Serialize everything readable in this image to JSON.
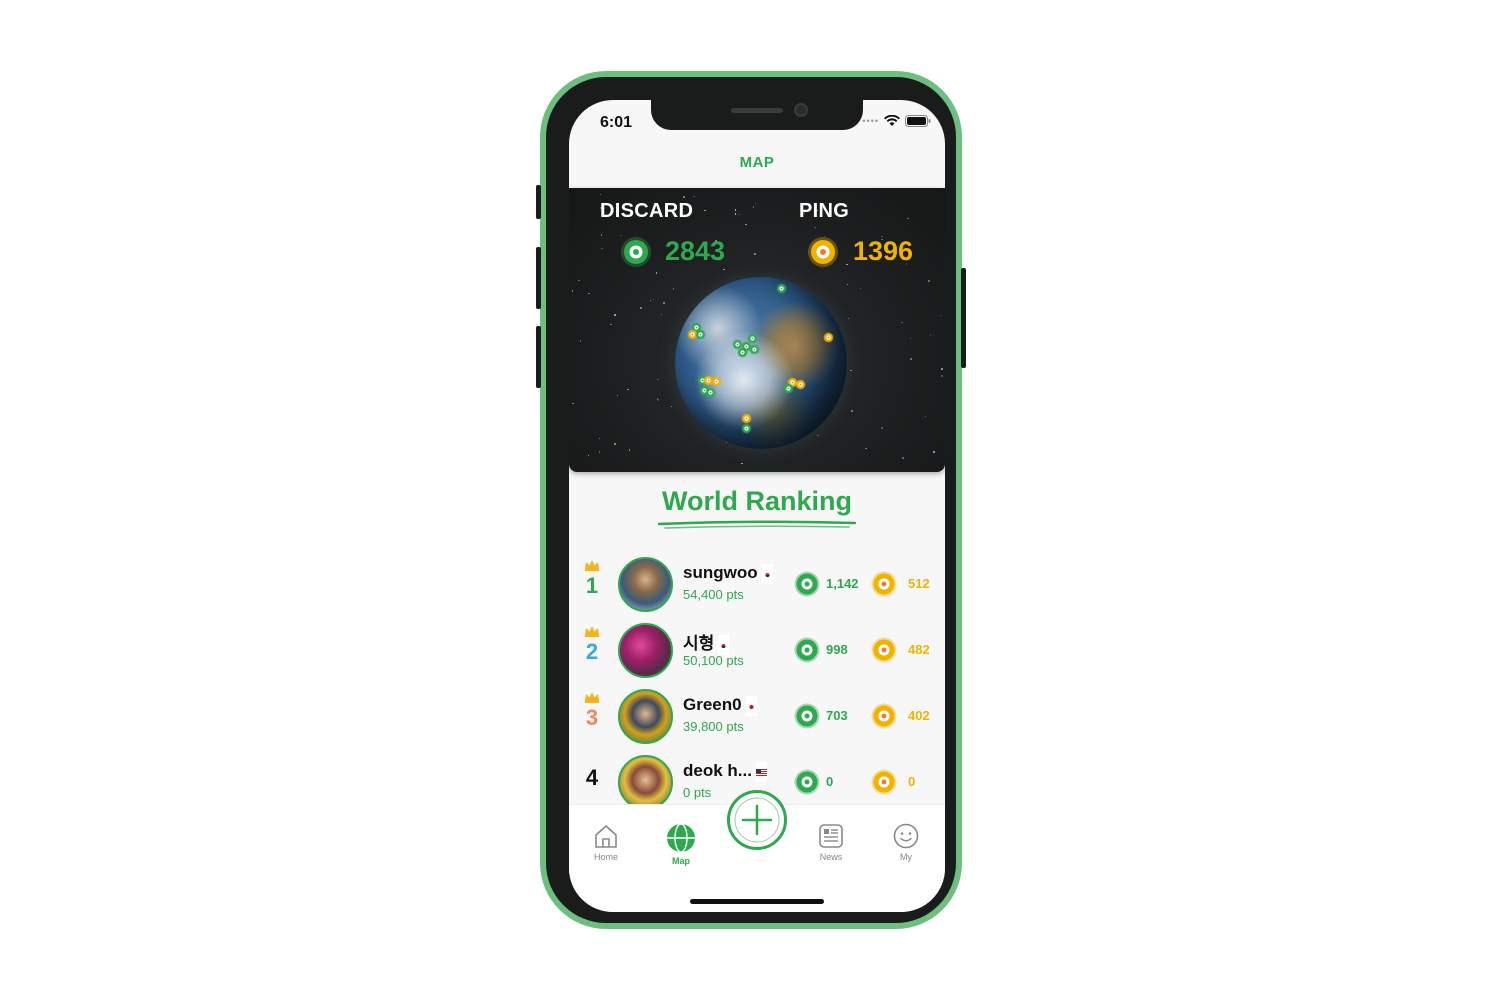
{
  "status": {
    "time": "6:01"
  },
  "nav": {
    "title": "MAP"
  },
  "counters": {
    "discard": {
      "label": "DISCARD",
      "value": "2843",
      "color": "#2fa84f"
    },
    "ping": {
      "label": "PING",
      "value": "1396",
      "color": "#f0b400"
    }
  },
  "ranking": {
    "title": "World Ranking",
    "rows": [
      {
        "rank": "1",
        "name": "sungwoo",
        "pts": "54,400 pts",
        "discard": "1,142",
        "ping": "512",
        "rank_color": "#2fa84f",
        "flag": "kr",
        "crown": true
      },
      {
        "rank": "2",
        "name": "시형",
        "pts": "50,100 pts",
        "discard": "998",
        "ping": "482",
        "rank_color": "#3aa8e0",
        "flag": "kr",
        "crown": true
      },
      {
        "rank": "3",
        "name": "Green0",
        "pts": "39,800 pts",
        "discard": "703",
        "ping": "402",
        "rank_color": "#f08a5d",
        "flag": "jp",
        "crown": true
      },
      {
        "rank": "4",
        "name": "deok h...",
        "pts": "0 pts",
        "discard": "0",
        "ping": "0",
        "rank_color": "#111111",
        "flag": "us",
        "crown": false
      }
    ]
  },
  "tabs": [
    {
      "label": "Home",
      "icon": "home-icon",
      "active": false
    },
    {
      "label": "Map",
      "icon": "globe-icon",
      "active": true
    },
    {
      "label": "News",
      "icon": "news-icon",
      "active": false
    },
    {
      "label": "My",
      "icon": "smiley-icon",
      "active": false
    }
  ],
  "colors": {
    "brand_green": "#2fa84f",
    "ping_yellow": "#f0b400",
    "phone_frame": "#6dbf80"
  }
}
